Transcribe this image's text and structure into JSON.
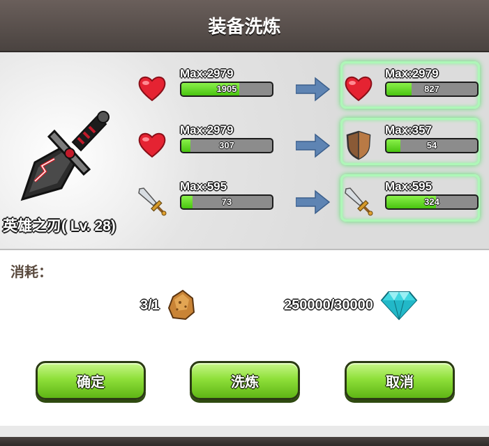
{
  "dialog": {
    "title": "装备洗炼"
  },
  "item": {
    "name": "英雄之刃( Lv. 28)",
    "icon": "sword-weapon-icon"
  },
  "stats": [
    {
      "current": {
        "icon": "heart-icon",
        "max_label": "Max:2979",
        "value": "1905",
        "max": 2979,
        "amount": 1905
      },
      "refined": {
        "icon": "heart-icon",
        "max_label": "Max:2979",
        "value": "827",
        "max": 2979,
        "amount": 827
      }
    },
    {
      "current": {
        "icon": "heart-icon",
        "max_label": "Max:2979",
        "value": "307",
        "max": 2979,
        "amount": 307
      },
      "refined": {
        "icon": "shield-icon",
        "max_label": "Max:357",
        "value": "54",
        "max": 357,
        "amount": 54
      }
    },
    {
      "current": {
        "icon": "sword-icon",
        "max_label": "Max:595",
        "value": "73",
        "max": 595,
        "amount": 73
      },
      "refined": {
        "icon": "sword-icon",
        "max_label": "Max:595",
        "value": "324",
        "max": 595,
        "amount": 324
      }
    }
  ],
  "cost": {
    "label": "消耗：",
    "stone": {
      "text": "3/1",
      "icon": "refine-stone-icon"
    },
    "diamond": {
      "text": "250000/30000",
      "icon": "diamond-icon"
    }
  },
  "buttons": {
    "confirm": "确定",
    "refine": "洗炼",
    "cancel": "取消"
  },
  "colors": {
    "bar_fill": "#49c410",
    "button_green": "#8fe03a",
    "glow": "#aef7b8",
    "title_bg": "#5a514d"
  }
}
